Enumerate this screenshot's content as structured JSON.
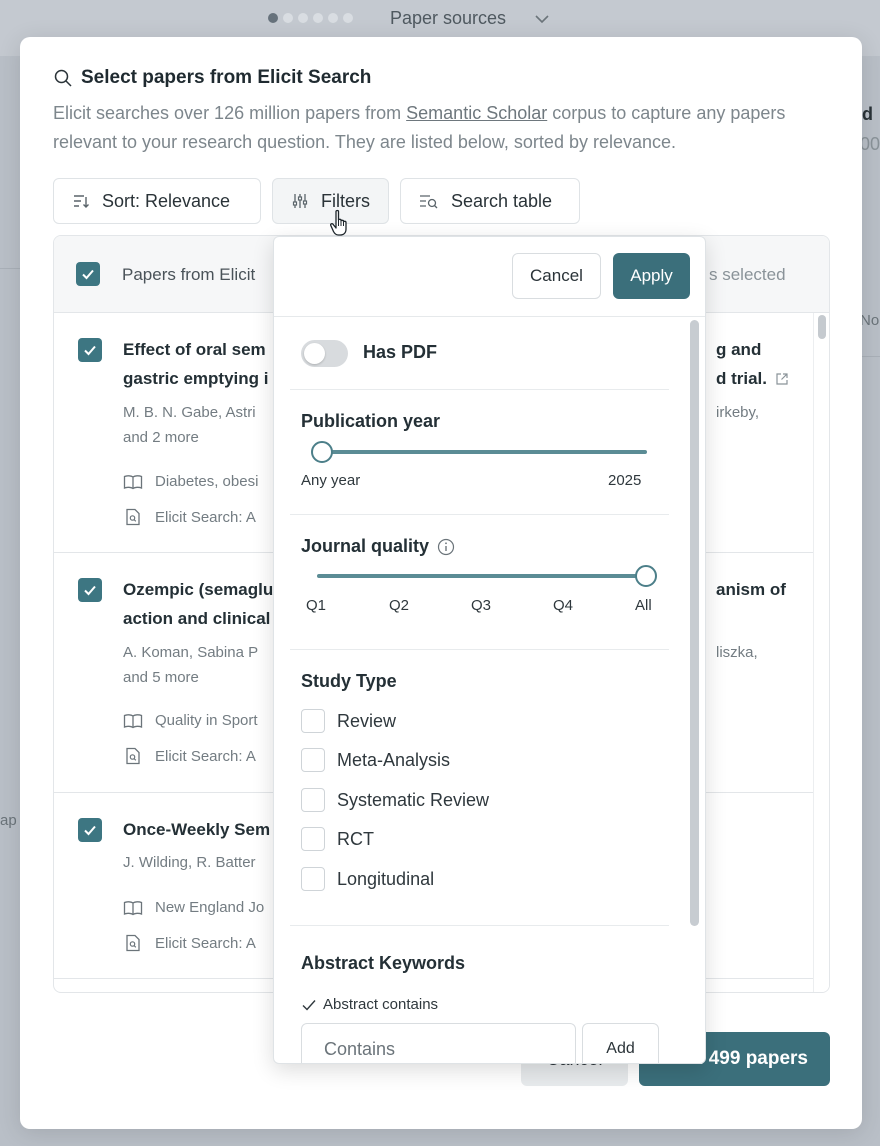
{
  "background": {
    "title": "Paper sources",
    "step_count": 6,
    "active_step": 1,
    "right_fragment_1": "d",
    "right_fragment_2": "00",
    "right_fragment_3": "No",
    "left_fragment": "ap"
  },
  "modal": {
    "title": "Select papers from Elicit Search",
    "description_before_link": "Elicit searches over 126 million papers from ",
    "description_link": "Semantic Scholar",
    "description_after_link": " corpus to capture any papers relevant to your research question. They are listed below, sorted by relevance.",
    "toolbar": {
      "sort_label": "Sort: Relevance",
      "filters_label": "Filters",
      "search_table_label": "Search table"
    },
    "table": {
      "header_label": "Papers from Elicit",
      "header_selected": "s selected",
      "rows": [
        {
          "title_left_1": "Effect of oral sem",
          "title_left_2": "gastric emptying i",
          "title_right_1": "g and",
          "title_right_2": "d trial.",
          "authors_left_1": "M. B. N. Gabe, Astri",
          "authors_left_2": "and 2 more",
          "authors_right": "irkeby,",
          "journal": "Diabetes, obesi",
          "source": "Elicit Search: A"
        },
        {
          "title_left_1": "Ozempic (semaglu",
          "title_left_2": "action and clinical",
          "title_right_1": "anism of",
          "title_right_2": "",
          "authors_left_1": "A. Koman, Sabina P",
          "authors_left_2": "and 5 more",
          "authors_right": "liszka,",
          "journal": "Quality in Sport",
          "source": "Elicit Search: A"
        },
        {
          "title_left_1": "Once-Weekly Sem",
          "title_left_2": "",
          "title_right_1": "",
          "title_right_2": "",
          "authors_left_1": "J. Wilding, R. Batter",
          "authors_left_2": "",
          "authors_right": "",
          "journal": "New England Jo",
          "source": "Elicit Search: A"
        }
      ]
    },
    "footer": {
      "cancel_label": "Cancel",
      "add_label": "Add 499 papers"
    }
  },
  "filters_popup": {
    "cancel_label": "Cancel",
    "apply_label": "Apply",
    "has_pdf_label": "Has PDF",
    "has_pdf_on": false,
    "publication_year": {
      "title": "Publication year",
      "min_label": "Any year",
      "max_label": "2025",
      "selected_fraction": 0
    },
    "journal_quality": {
      "title": "Journal quality",
      "ticks": [
        "Q1",
        "Q2",
        "Q3",
        "Q4",
        "All"
      ],
      "selected": "All"
    },
    "study_type": {
      "title": "Study Type",
      "options": [
        "Review",
        "Meta-Analysis",
        "Systematic Review",
        "RCT",
        "Longitudinal"
      ]
    },
    "abstract_keywords": {
      "title": "Abstract Keywords",
      "mode_label": "Abstract contains",
      "input_placeholder": "Contains",
      "add_label": "Add"
    }
  },
  "colors": {
    "accent": "#3b6f7b",
    "checkbox": "#3d7682",
    "overlay": "#b9bfc7"
  },
  "icons": [
    "search-icon",
    "sort-icon",
    "sliders-icon",
    "search-table-icon",
    "checkmark-icon",
    "external-link-icon",
    "book-icon",
    "document-icon",
    "info-icon",
    "chevron-down-icon",
    "hand-pointer-cursor"
  ]
}
